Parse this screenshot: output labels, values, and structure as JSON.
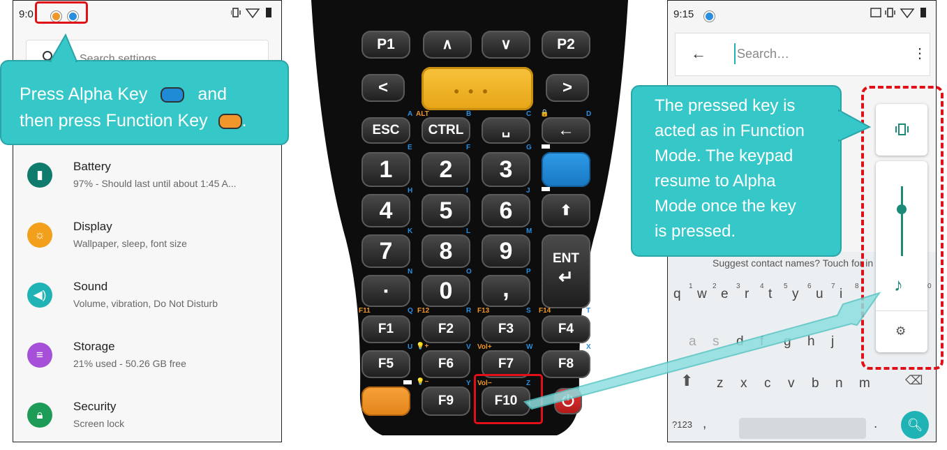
{
  "left_phone": {
    "status_time": "9:0",
    "search_placeholder": "Search settings",
    "settings": [
      {
        "title": "Battery",
        "subtitle": "97% - Should last until about 1:45 A...",
        "icon": "battery-icon",
        "color": "#0f7b6c"
      },
      {
        "title": "Display",
        "subtitle": "Wallpaper, sleep, font size",
        "icon": "brightness-icon",
        "color": "#f29f1c"
      },
      {
        "title": "Sound",
        "subtitle": "Volume, vibration, Do Not Disturb",
        "icon": "volume-icon",
        "color": "#20b3b5"
      },
      {
        "title": "Storage",
        "subtitle": "21% used - 50.26 GB free",
        "icon": "storage-icon",
        "color": "#a64fd8"
      },
      {
        "title": "Security",
        "subtitle": "Screen lock",
        "icon": "lock-icon",
        "color": "#1c9c56"
      }
    ]
  },
  "callout_left": {
    "line1": "Press Alpha Key",
    "and": "and",
    "line2": "then press Function Key",
    "period": "."
  },
  "keypad": {
    "row1": [
      "P1",
      "∧",
      "∨",
      "P2"
    ],
    "row2": [
      "<",
      ">"
    ],
    "row3": [
      "ESC",
      "CTRL",
      "␣",
      "←"
    ],
    "row4": [
      "1",
      "2",
      "3"
    ],
    "row5": [
      "4",
      "5",
      "6",
      "⬆"
    ],
    "row6": [
      "7",
      "8",
      "9",
      "ENT",
      "↵"
    ],
    "row7": [
      "▪",
      "0",
      ","
    ],
    "row8": [
      "F1",
      "F2",
      "F3",
      "F4"
    ],
    "row9": [
      "F5",
      "F6",
      "F7",
      "F8"
    ],
    "row10": [
      "F9",
      "F10",
      "⏻"
    ],
    "letter_labels": [
      "A",
      "B",
      "C",
      "D",
      "E",
      "F",
      "G",
      "H",
      "I",
      "J",
      "K",
      "L",
      "M",
      "N",
      "O",
      "P",
      "Q",
      "R",
      "S",
      "T",
      "U",
      "V",
      "W",
      "X",
      "Y",
      "Z"
    ],
    "function_labels": [
      "ALT",
      "F11",
      "F12",
      "F13",
      "F14",
      "Vol+",
      "Vol−"
    ],
    "colors": {
      "alpha": "#1f8ad6",
      "function": "#f0962a",
      "scan": "#f5b521",
      "power": "#d8232a"
    }
  },
  "right_phone": {
    "status_time": "9:15",
    "search_placeholder": "Search…",
    "suggest_text": "Suggest contact names? Touch for in",
    "keyboard": {
      "row1": [
        "q",
        "w",
        "e",
        "r",
        "t",
        "y",
        "u",
        "i"
      ],
      "row1_nums": [
        "1",
        "2",
        "3",
        "4",
        "5",
        "6",
        "7",
        "8",
        "0"
      ],
      "row2": [
        "a",
        "s",
        "d",
        "f",
        "g",
        "h",
        "j"
      ],
      "row3": [
        "z",
        "x",
        "c",
        "v",
        "b",
        "n",
        "m"
      ],
      "symbols_key": "?123",
      "comma": ",",
      "period": "."
    }
  },
  "callout_right": {
    "lines": [
      "The pressed key is",
      "acted as in Function",
      "Mode. The keypad",
      "resume to Alpha",
      "Mode once the key",
      "is pressed."
    ]
  },
  "accent_colors": {
    "teal": "#36c7c9",
    "red_highlight": "#e01018"
  }
}
